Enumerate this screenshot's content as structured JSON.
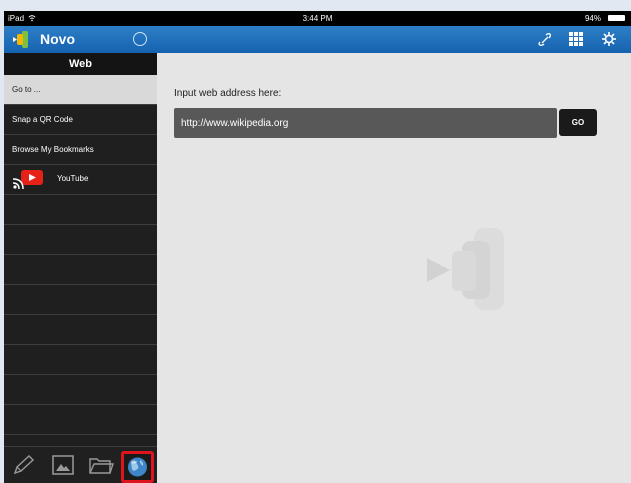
{
  "status_bar": {
    "device": "iPad",
    "time": "3:44 PM",
    "battery": "94%"
  },
  "app": {
    "title": "Novo"
  },
  "sidebar": {
    "section_title": "Web",
    "items": [
      {
        "label": "Go to ...",
        "selected": true
      },
      {
        "label": "Snap a QR Code"
      },
      {
        "label": "Browse My Bookmarks"
      },
      {
        "label": "YouTube",
        "icon": "youtube-icon"
      }
    ],
    "bottom_tabs": [
      "pen-icon",
      "image-icon",
      "folder-icon",
      "globe-icon"
    ]
  },
  "toolbar": {
    "icons": [
      "link-icon",
      "grid-icon",
      "settings-icon"
    ]
  },
  "main": {
    "prompt": "Input web address here:",
    "url_value": "http://www.wikipedia.org",
    "go_label": "GO"
  },
  "colors": {
    "header_blue": "#1a6bb8",
    "highlight_red": "#e0141e"
  }
}
